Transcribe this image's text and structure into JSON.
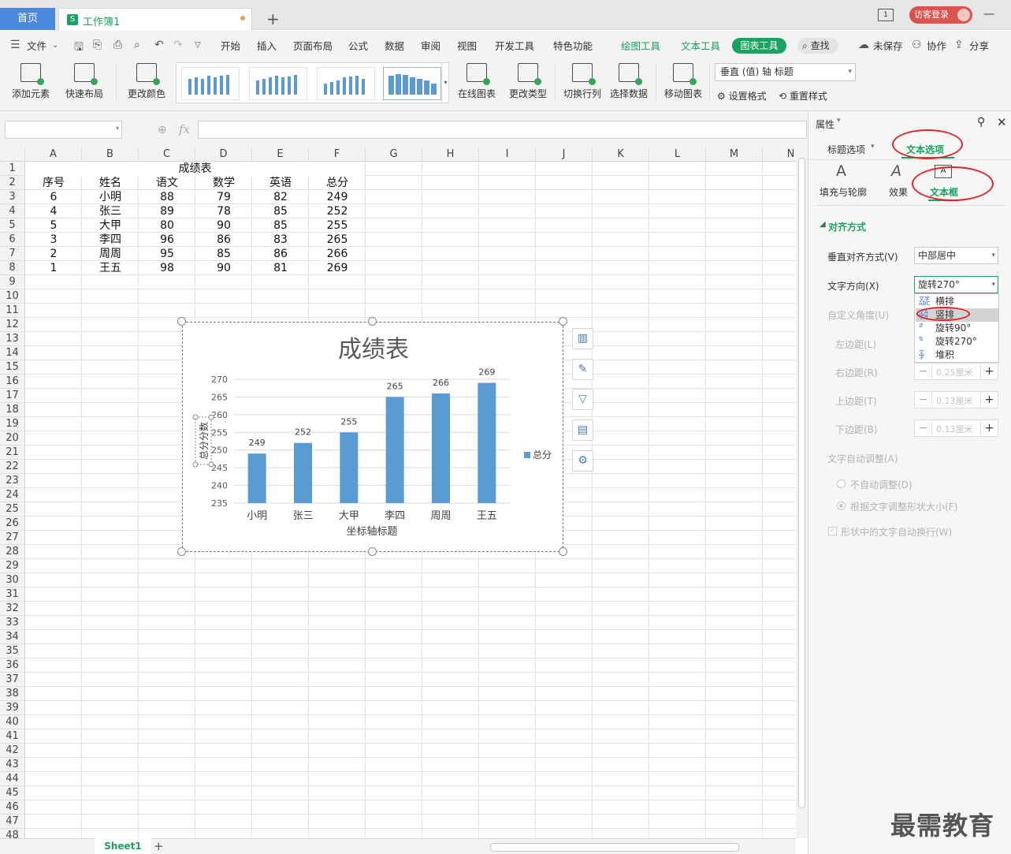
{
  "tabs": {
    "home": "首页",
    "doc": "工作簿1",
    "new": "+"
  },
  "titlebar": {
    "login": "访客登录",
    "badge": "1"
  },
  "menu": {
    "items": [
      "文件",
      "开始",
      "插入",
      "页面布局",
      "公式",
      "数据",
      "审阅",
      "视图",
      "开发工具",
      "特色功能",
      "绘图工具",
      "文本工具",
      "图表工具",
      "查找",
      "未保存",
      "协作",
      "分享"
    ]
  },
  "ribbon": {
    "add_element": "添加元素",
    "quick_layout": "快速布局",
    "change_color": "更改颜色",
    "online_chart": "在线图表",
    "change_type": "更改类型",
    "switch_rowcol": "切换行列",
    "select_data": "选择数据",
    "move_chart": "移动图表",
    "element_select": "垂直 (值) 轴 标题",
    "set_format": "设置格式",
    "reset_style": "重置样式"
  },
  "columns": [
    "A",
    "B",
    "C",
    "D",
    "E",
    "F",
    "G",
    "H",
    "I",
    "J",
    "K",
    "L",
    "M",
    "N"
  ],
  "sheet": {
    "title": "成绩表",
    "headers": [
      "序号",
      "姓名",
      "语文",
      "数学",
      "英语",
      "总分"
    ],
    "rows": [
      [
        "6",
        "小明",
        "88",
        "79",
        "82",
        "249"
      ],
      [
        "4",
        "张三",
        "89",
        "78",
        "85",
        "252"
      ],
      [
        "5",
        "大甲",
        "80",
        "90",
        "85",
        "255"
      ],
      [
        "3",
        "李四",
        "96",
        "86",
        "83",
        "265"
      ],
      [
        "2",
        "周周",
        "95",
        "85",
        "86",
        "266"
      ],
      [
        "1",
        "王五",
        "98",
        "90",
        "81",
        "269"
      ]
    ]
  },
  "chart_data": {
    "type": "bar",
    "title": "成绩表",
    "categories": [
      "小明",
      "张三",
      "大甲",
      "李四",
      "周周",
      "王五"
    ],
    "series": [
      {
        "name": "总分",
        "values": [
          249,
          252,
          255,
          265,
          266,
          269
        ],
        "color": "#5b9bd5"
      }
    ],
    "xlabel": "坐标轴标题",
    "ylabel": "总分分数",
    "ylim": [
      235,
      270
    ],
    "yticks": [
      235,
      240,
      245,
      250,
      255,
      260,
      265,
      270
    ],
    "legend": "right",
    "grid": true
  },
  "panel": {
    "title": "属性",
    "tab_title_opts": "标题选项",
    "tab_text_opts": "文本选项",
    "sub_fill": "填充与轮廓",
    "sub_effect": "效果",
    "sub_textbox": "文本框",
    "section": "对齐方式",
    "vertical_align_label": "垂直对齐方式(V)",
    "vertical_align_value": "中部居中",
    "text_dir_label": "文字方向(X)",
    "text_dir_value": "旋转270°",
    "dir_options": [
      "横排",
      "竖排",
      "旋转90°",
      "旋转270°",
      "堆积"
    ],
    "custom_angle": "自定义角度(U)",
    "left_margin": "左边距(L)",
    "right_margin": "右边距(R)",
    "top_margin": "上边距(T)",
    "bottom_margin": "下边距(B)",
    "right_val": "0.25厘米",
    "top_val": "0.13厘米",
    "bottom_val": "0.13厘米",
    "autofit": "文字自动调整(A)",
    "no_autofit": "不自动调整(D)",
    "resize_shape": "根据文字调整形状大小(F)",
    "wrap": "形状中的文字自动换行(W)"
  },
  "sheet_tab": "Sheet1",
  "watermark": "最需教育"
}
